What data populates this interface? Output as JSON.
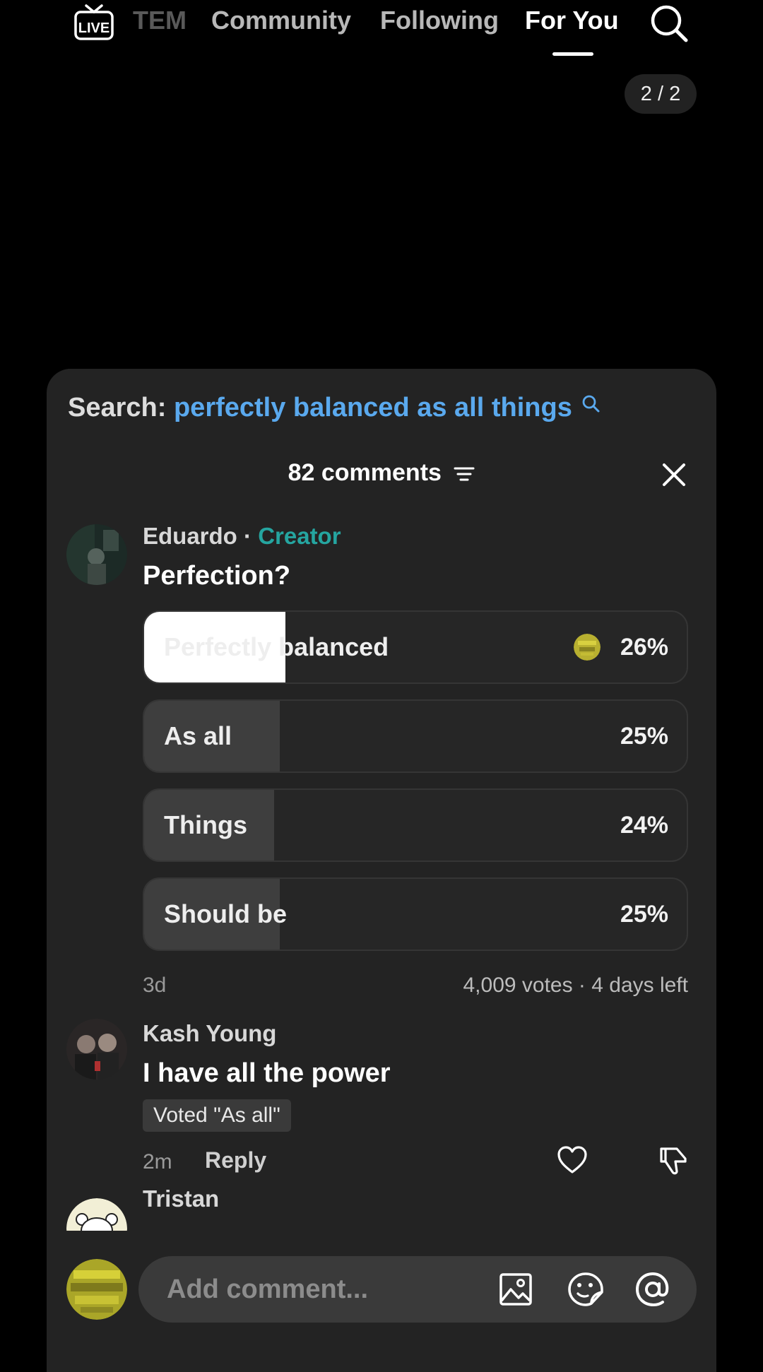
{
  "nav": {
    "live_label": "LIVE",
    "tabs": [
      "TEM",
      "Community",
      "Following",
      "For You"
    ],
    "active_tab": "For You"
  },
  "counter": "2 / 2",
  "sheet": {
    "search_prefix": "Search:",
    "search_query": "perfectly balanced as all things",
    "comments_title": "82 comments"
  },
  "comments": [
    {
      "author": "Eduardo",
      "separator": "·",
      "badge": "Creator",
      "text": "Perfection?",
      "poll": {
        "options": [
          {
            "label": "Perfectly balanced",
            "percent": "26%",
            "fill": 0.26,
            "selected": true
          },
          {
            "label": "As all",
            "percent": "25%",
            "fill": 0.25,
            "selected": false
          },
          {
            "label": "Things",
            "percent": "24%",
            "fill": 0.24,
            "selected": false
          },
          {
            "label": "Should be",
            "percent": "25%",
            "fill": 0.25,
            "selected": false
          }
        ]
      },
      "time": "3d",
      "votes_info": "4,009 votes · 4 days left"
    },
    {
      "author": "Kash Young",
      "text": "I have all the power",
      "voted": "Voted \"As all\"",
      "time": "2m",
      "reply_label": "Reply"
    },
    {
      "author": "Tristan"
    }
  ],
  "input": {
    "placeholder": "Add comment..."
  },
  "colors": {
    "accent_link": "#5aa9ee",
    "creator": "#25a5a0",
    "sheet_bg": "#232323"
  }
}
